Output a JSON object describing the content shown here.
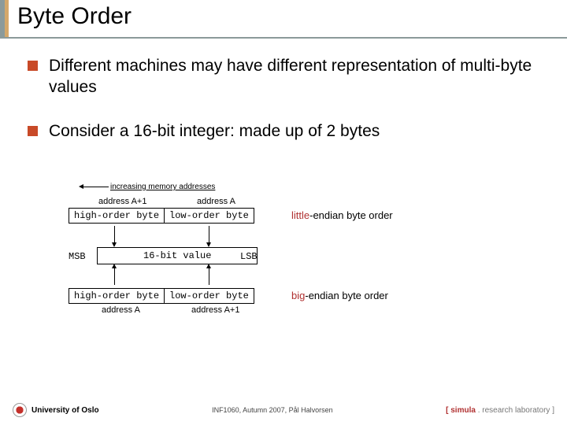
{
  "title": "Byte Order",
  "bullets": {
    "b1": "Different machines may have different representation of multi-byte values",
    "b2": "Consider a 16-bit integer: made up of 2 bytes"
  },
  "diagram": {
    "increasing": "increasing memory addresses",
    "addr_a1": "address A+1",
    "addr_a": "address A",
    "high": "high-order byte",
    "low": "low-order byte",
    "msb": "MSB",
    "mid": "16-bit value",
    "lsb": "LSB",
    "little_prefix": "little",
    "little_rest": "-endian byte order",
    "big_prefix": "big",
    "big_rest": "-endian byte order"
  },
  "footer": {
    "uni": "University of Oslo",
    "mid": "INF1060, Autumn 2007, Pål Halvorsen",
    "r1": "[ simula",
    "r2": " . research laboratory ]"
  }
}
